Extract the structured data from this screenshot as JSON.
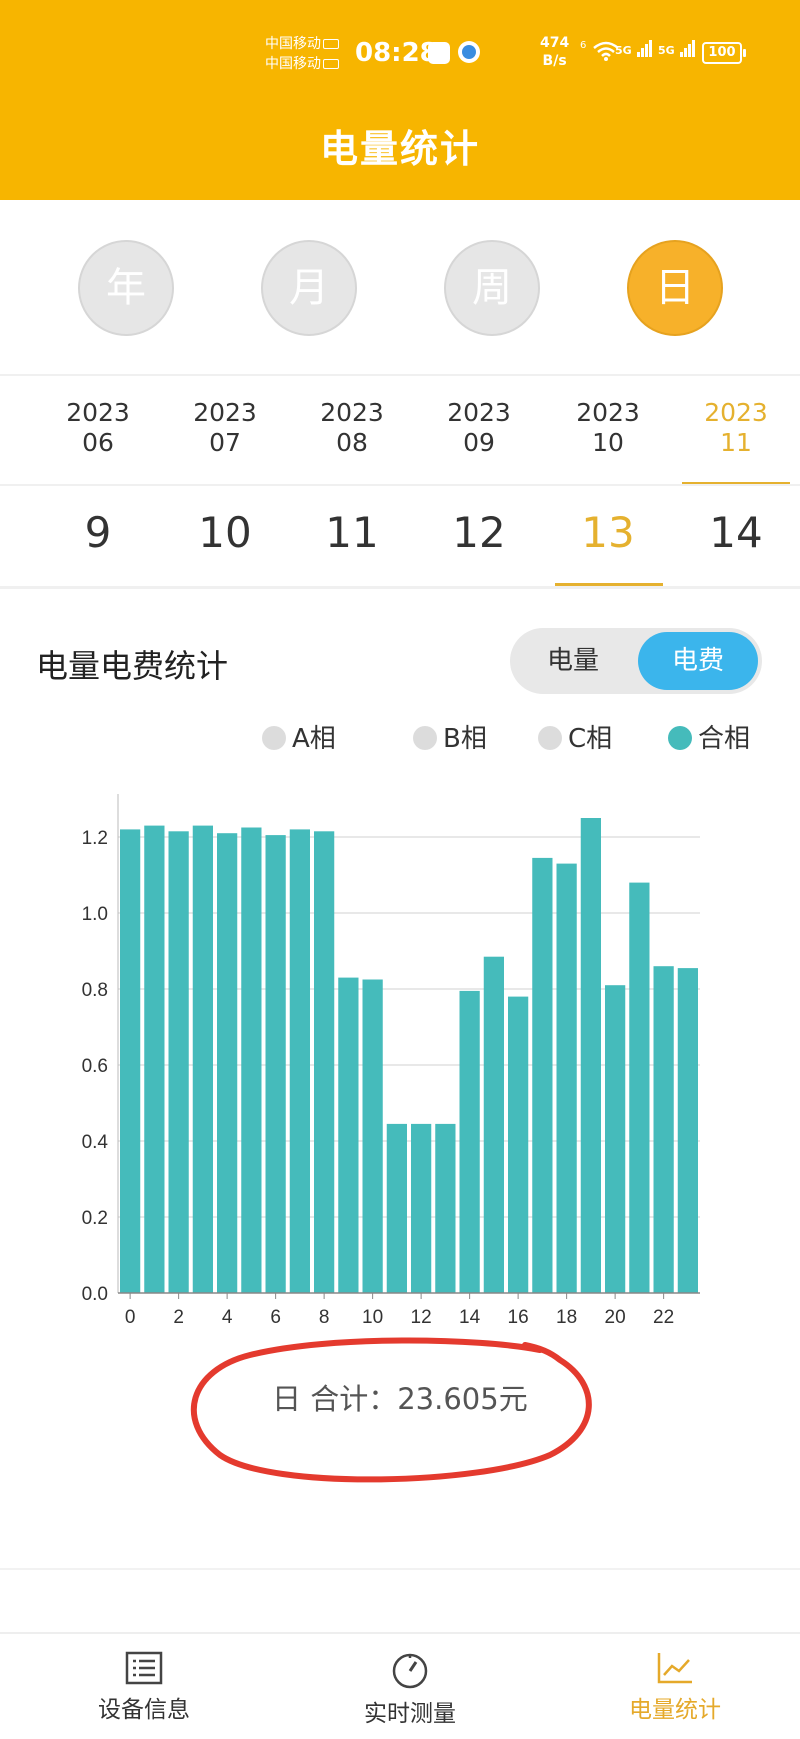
{
  "status_bar": {
    "carrier1": "中国移动",
    "carrier2": "中国移动",
    "time": "08:28",
    "net_speed_top": "474",
    "net_speed_bottom": "B/s",
    "wifi_badge": "6",
    "sig1_label": "5G",
    "sig2_label": "5G",
    "battery": "100"
  },
  "header": {
    "title": "电量统计"
  },
  "period_buttons": [
    {
      "label": "年",
      "active": false
    },
    {
      "label": "月",
      "active": false
    },
    {
      "label": "周",
      "active": false
    },
    {
      "label": "日",
      "active": true
    }
  ],
  "months": [
    {
      "year": "2023",
      "month": "06"
    },
    {
      "year": "2023",
      "month": "07"
    },
    {
      "year": "2023",
      "month": "08"
    },
    {
      "year": "2023",
      "month": "09"
    },
    {
      "year": "2023",
      "month": "10"
    },
    {
      "year": "2023",
      "month": "11",
      "active": true
    }
  ],
  "days": [
    "9",
    "10",
    "11",
    "12",
    "13",
    "14"
  ],
  "active_day": "13",
  "section": {
    "title": "电量电费统计",
    "toggle": [
      "电量",
      "电费"
    ],
    "toggle_active": "电费"
  },
  "legend": [
    {
      "label": "A相",
      "color": "#dcdcdc"
    },
    {
      "label": "B相",
      "color": "#dcdcdc"
    },
    {
      "label": "C相",
      "color": "#dcdcdc"
    },
    {
      "label": "合相",
      "color": "#45BBBB"
    }
  ],
  "chart_data": {
    "type": "bar",
    "categories": [
      "0",
      "1",
      "2",
      "3",
      "4",
      "5",
      "6",
      "7",
      "8",
      "9",
      "10",
      "11",
      "12",
      "13",
      "14",
      "15",
      "16",
      "17",
      "18",
      "19",
      "20",
      "21",
      "22",
      "23"
    ],
    "x_tick_labels": [
      "0",
      "2",
      "4",
      "6",
      "8",
      "10",
      "12",
      "14",
      "16",
      "18",
      "20",
      "22"
    ],
    "values": [
      1.22,
      1.23,
      1.215,
      1.23,
      1.21,
      1.225,
      1.205,
      1.22,
      1.215,
      0.83,
      0.825,
      0.445,
      0.445,
      0.445,
      0.795,
      0.885,
      0.78,
      1.145,
      1.13,
      1.25,
      0.81,
      1.08,
      0.86,
      0.855
    ],
    "ylim": [
      0,
      1.35
    ],
    "y_ticks": [
      "0.0",
      "0.2",
      "0.4",
      "0.6",
      "0.8",
      "1.0",
      "1.2"
    ],
    "grid": true,
    "bar_color": "#45BBBB",
    "title": "",
    "xlabel": "",
    "ylabel": ""
  },
  "total_text": "日 合计：23.605元",
  "bottom_nav": [
    {
      "label": "设备信息",
      "icon": "list-icon",
      "active": false
    },
    {
      "label": "实时测量",
      "icon": "gauge-icon",
      "active": false
    },
    {
      "label": "电量统计",
      "icon": "line-chart-icon",
      "active": true
    }
  ],
  "colors": {
    "header": "#F7B500",
    "accent": "#E5B12F",
    "toggle_active": "#3BB5EC"
  }
}
